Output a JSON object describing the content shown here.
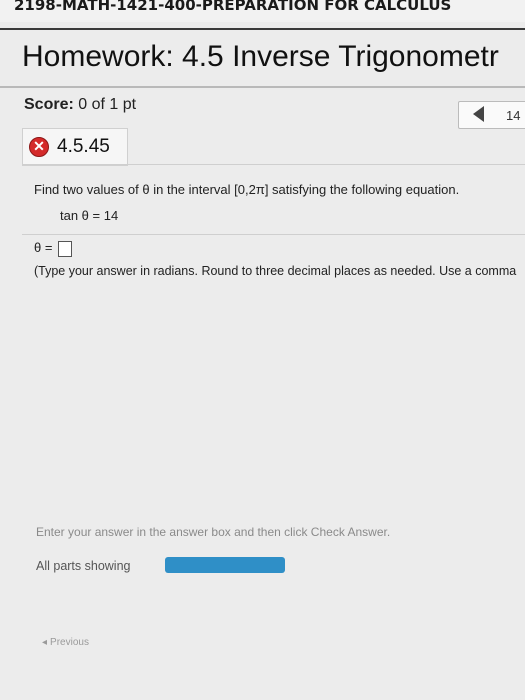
{
  "course": {
    "title": "2198-MATH-1421-400-PREPARATION FOR CALCULUS"
  },
  "homework": {
    "title": "Homework: 4.5 Inverse Trigonometr"
  },
  "score": {
    "label": "Score:",
    "value": "0 of 1 pt"
  },
  "nav": {
    "question_number": "14"
  },
  "question": {
    "id": "4.5.45",
    "status_icon": "incorrect-x-icon",
    "prompt": "Find two values of θ in the interval [0,2π] satisfying the following equation.",
    "equation": "tan θ = 14",
    "answer_label": "θ =",
    "answer_value": "",
    "instruction": "(Type your answer in radians. Round to three decimal places as needed. Use a comma"
  },
  "footer": {
    "hint": "Enter your answer in the answer box and then click Check Answer.",
    "parts_label": "All parts showing",
    "parts_progress": 1.0,
    "prev_label": "Previous"
  },
  "colors": {
    "incorrect": "#d42a2a",
    "progress": "#2f8fc7"
  }
}
